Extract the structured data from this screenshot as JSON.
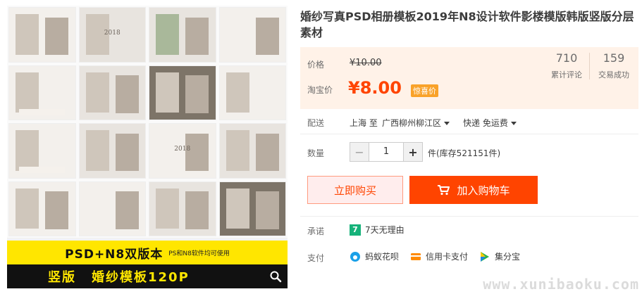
{
  "product": {
    "title": "婚纱写真PSD相册模板2019年N8设计软件影楼模版韩版竖版分层素材",
    "image": {
      "banner_line1": "PSD+N8双版本",
      "banner_line1_small": "PS和N8软件均可使用",
      "banner_line2_a": "竖版",
      "banner_line2_b": "婚纱模板120P",
      "tile_year": "2018"
    }
  },
  "price": {
    "label": "价格",
    "original": "¥10.00",
    "taobao_label": "淘宝价",
    "current": "¥8.00",
    "tag": "惊喜价"
  },
  "stats": [
    {
      "num": "710",
      "caption": "累计评论"
    },
    {
      "num": "159",
      "caption": "交易成功"
    }
  ],
  "delivery": {
    "label": "配送",
    "from": "上海 至",
    "to": "广西柳州柳江区",
    "method": "快递 免运费"
  },
  "quantity": {
    "label": "数量",
    "value": "1",
    "minus": "−",
    "plus": "+",
    "stock": "件(库存521151件)"
  },
  "actions": {
    "buy_now": "立即购买",
    "add_to_cart": "加入购物车"
  },
  "promise": {
    "label": "承诺",
    "icon_text": "7",
    "text": "7天无理由"
  },
  "payment": {
    "label": "支付",
    "methods": [
      "蚂蚁花呗",
      "信用卡支付",
      "集分宝"
    ]
  },
  "watermark": "www.xunibaoku.com",
  "colors": {
    "accent": "#ff4400",
    "price_bg": "#fff2e8",
    "tag": "#f9a229",
    "banner_yellow": "#ffe600"
  }
}
